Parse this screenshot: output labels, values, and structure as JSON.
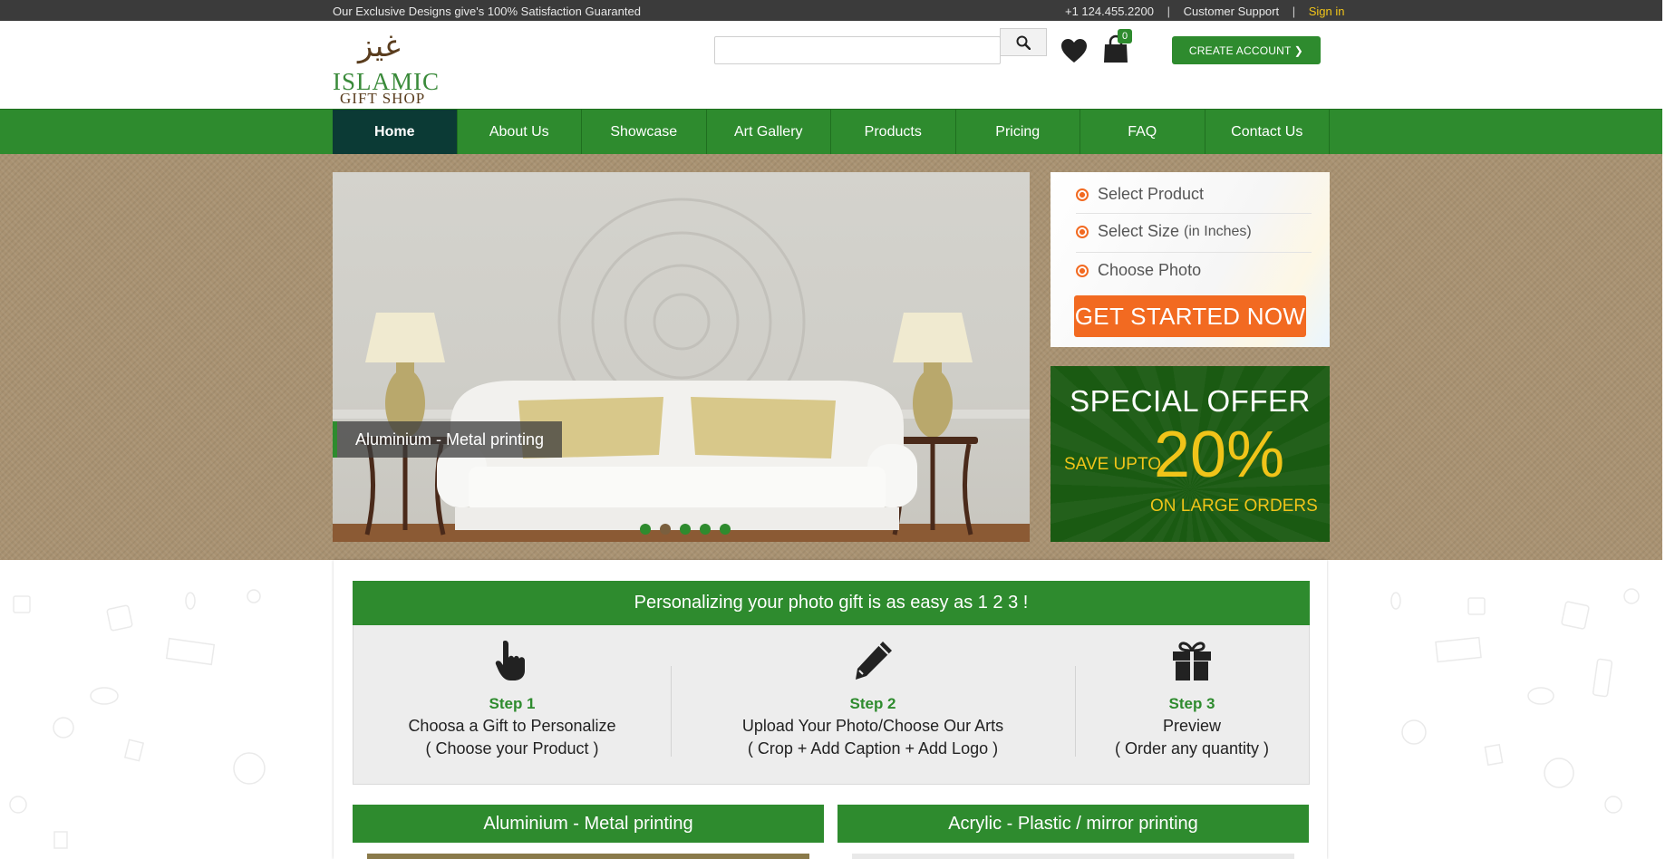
{
  "topbar": {
    "tagline": "Our Exclusive Designs give's 100% Satisfaction Guaranted",
    "phone": "+1 124.455.2200",
    "separator": "|",
    "support": "Customer Support",
    "signin": "Sign in"
  },
  "header": {
    "logo": {
      "arabic": "غيز",
      "line1": "ISLAMIC",
      "line2": "GIFT SHOP"
    },
    "search": {
      "placeholder": ""
    },
    "cart_count": "0",
    "create_account": "CREATE ACCOUNT ❯"
  },
  "nav": {
    "items": [
      {
        "label": "Home"
      },
      {
        "label": "About Us"
      },
      {
        "label": "Showcase"
      },
      {
        "label": "Art Gallery"
      },
      {
        "label": "Products"
      },
      {
        "label": "Pricing"
      },
      {
        "label": "FAQ"
      },
      {
        "label": "Contact Us"
      }
    ]
  },
  "slider": {
    "caption": "Aluminium - Metal printing",
    "active_dot": 2,
    "dot_count": 5
  },
  "widget": {
    "options": [
      {
        "label": "Select Product",
        "note": ""
      },
      {
        "label": "Select Size",
        "note": "(in Inches)"
      },
      {
        "label": "Choose Photo",
        "note": ""
      }
    ],
    "cta": "GET STARTED NOW"
  },
  "offer": {
    "title": "SPECIAL OFFER",
    "save": "SAVE UPTO",
    "percent": "20%",
    "sub": "ON LARGE ORDERS"
  },
  "steps": {
    "heading": "Personalizing your photo gift is as easy as 1 2 3 !",
    "items": [
      {
        "icon": "pointer-hand-icon",
        "title": "Step 1",
        "line1": "Choosa a Gift to Personalize",
        "line2": "( Choose your Product )"
      },
      {
        "icon": "pencil-icon",
        "title": "Step 2",
        "line1": "Upload Your Photo/Choose Our Arts",
        "line2": "( Crop + Add Caption + Add Logo )"
      },
      {
        "icon": "gift-icon",
        "title": "Step 3",
        "line1": "Preview",
        "line2": "( Order any quantity )"
      }
    ]
  },
  "products": [
    {
      "title": "Aluminium - Metal printing"
    },
    {
      "title": "Acrylic - Plastic / mirror printing"
    }
  ],
  "colors": {
    "brand_green": "#2e8b2e",
    "nav_active": "#0b3a35",
    "cta_orange": "#f26a21",
    "offer_yellow": "#f0c419",
    "offer_bg": "#1a5a12"
  }
}
